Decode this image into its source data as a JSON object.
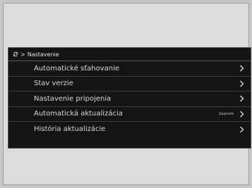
{
  "header": {
    "icon": "settings-icon",
    "separator": ">",
    "title": "Nastavenie"
  },
  "menu": {
    "items": [
      {
        "label": "Automatické sťahovanie",
        "badge": ""
      },
      {
        "label": "Stav verzie",
        "badge": ""
      },
      {
        "label": "Nastavenie pripojenia",
        "badge": ""
      },
      {
        "label": "Automatická aktualizácia",
        "badge": "Zapnuté"
      },
      {
        "label": "História aktualizácie",
        "badge": ""
      }
    ],
    "chevron_icon": "chevron-right-icon"
  },
  "colors": {
    "screen_bg": "#141414",
    "text": "#d8d8d8",
    "divider": "#3e3e3e"
  }
}
